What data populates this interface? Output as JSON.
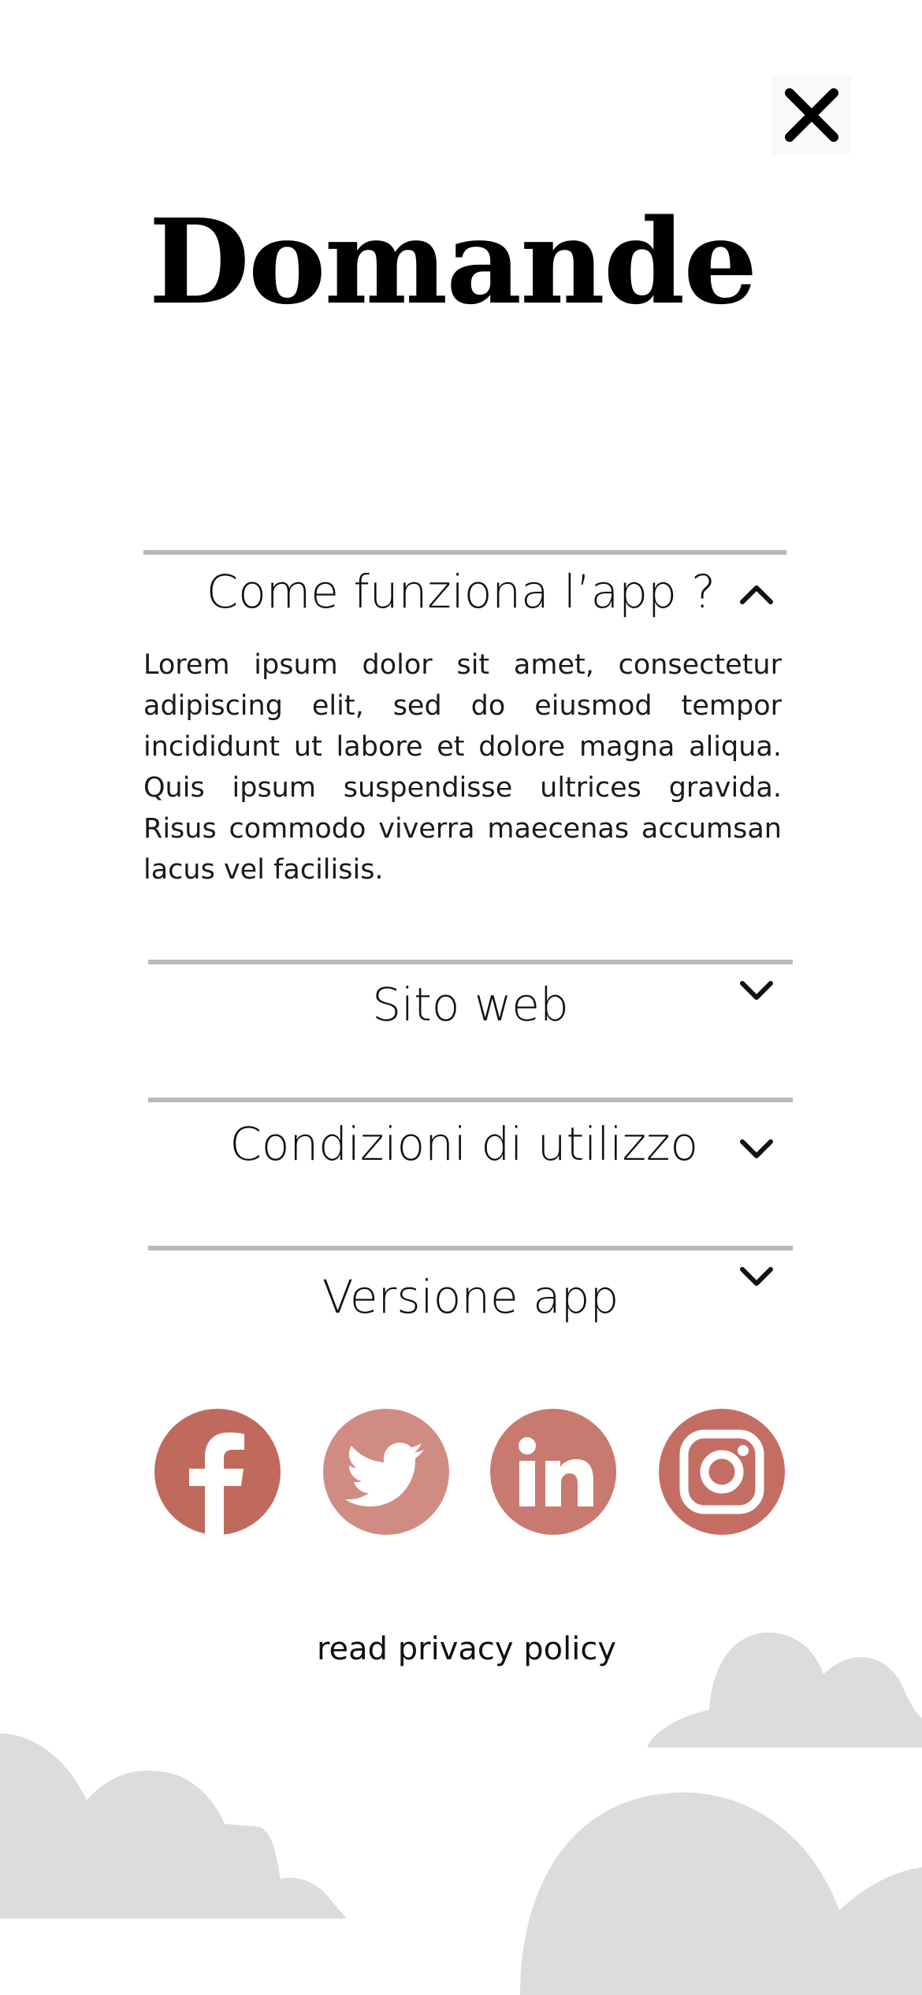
{
  "header": {
    "title": "Domande",
    "close_icon": "close-icon"
  },
  "faq": [
    {
      "question": "Come funziona l’app ?",
      "expanded": true,
      "answer": "Lorem ipsum dolor sit amet, consectetur adipiscing elit, sed do eiusmod tempor incididunt ut labore et dolore magna aliqua. Quis ipsum suspendisse ultrices gravida. Risus commodo viverra maecenas accumsan lacus vel facilisis."
    },
    {
      "question": "Sito web",
      "expanded": false
    },
    {
      "question": "Condizioni di utilizzo",
      "expanded": false
    },
    {
      "question": "Versione app",
      "expanded": false
    }
  ],
  "social": [
    {
      "icon": "facebook-icon",
      "color": "#c06a5e"
    },
    {
      "icon": "twitter-icon",
      "color": "#d08c82"
    },
    {
      "icon": "linkedin-icon",
      "color": "#c87a70"
    },
    {
      "icon": "instagram-icon",
      "color": "#c46e63"
    }
  ],
  "footer": {
    "privacy_link": "read privacy policy"
  },
  "colors": {
    "divider": "#b9b9b9",
    "cloud": "#dcdcdc",
    "text": "#111111"
  }
}
